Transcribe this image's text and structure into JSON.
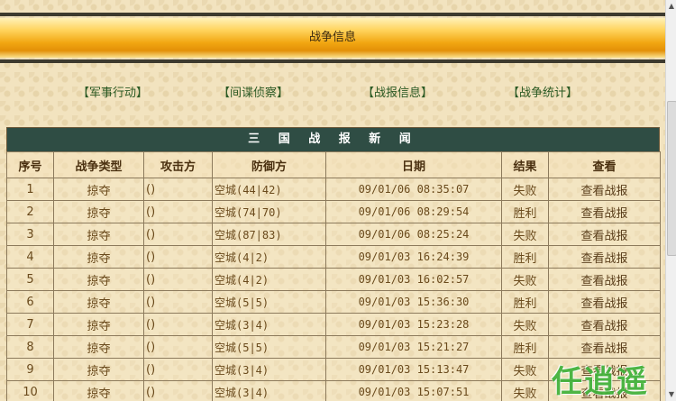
{
  "header": {
    "title": "战争信息"
  },
  "nav": {
    "military": "【军事行动】",
    "spy": "【间谍侦察】",
    "report": "【战报信息】",
    "stats": "【战争统计】"
  },
  "table": {
    "caption": "三 国 战 报 新 闻",
    "columns": [
      "序号",
      "战争类型",
      "攻击方",
      "防御方",
      "日期",
      "结果",
      "查看"
    ],
    "rows": [
      [
        "1",
        "掠夺",
        "()",
        "空城(44|42)",
        "09/01/06 08:35:07",
        "失败",
        "查看战报"
      ],
      [
        "2",
        "掠夺",
        "()",
        "空城(74|70)",
        "09/01/06 08:29:54",
        "胜利",
        "查看战报"
      ],
      [
        "3",
        "掠夺",
        "()",
        "空城(87|83)",
        "09/01/06 08:25:24",
        "失败",
        "查看战报"
      ],
      [
        "4",
        "掠夺",
        "()",
        "空城(4|2)",
        "09/01/03 16:24:39",
        "胜利",
        "查看战报"
      ],
      [
        "5",
        "掠夺",
        "()",
        "空城(4|2)",
        "09/01/03 16:02:57",
        "失败",
        "查看战报"
      ],
      [
        "6",
        "掠夺",
        "()",
        "空城(5|5)",
        "09/01/03 15:36:30",
        "胜利",
        "查看战报"
      ],
      [
        "7",
        "掠夺",
        "()",
        "空城(3|4)",
        "09/01/03 15:23:28",
        "失败",
        "查看战报"
      ],
      [
        "8",
        "掠夺",
        "()",
        "空城(5|5)",
        "09/01/03 15:21:27",
        "胜利",
        "查看战报"
      ],
      [
        "9",
        "掠夺",
        "()",
        "空城(3|4)",
        "09/01/03 15:13:47",
        "失败",
        "查看战报"
      ],
      [
        "10",
        "掠夺",
        "()",
        "空城(3|4)",
        "09/01/03 15:07:51",
        "失败",
        "查看战报"
      ]
    ]
  },
  "watermark": {
    "text": "任逍遥"
  },
  "colors": {
    "header_gold": "#f2a712",
    "table_caption_bg": "#2f4d44",
    "nav_link": "#2b5a24",
    "watermark": "#3fb23a"
  }
}
